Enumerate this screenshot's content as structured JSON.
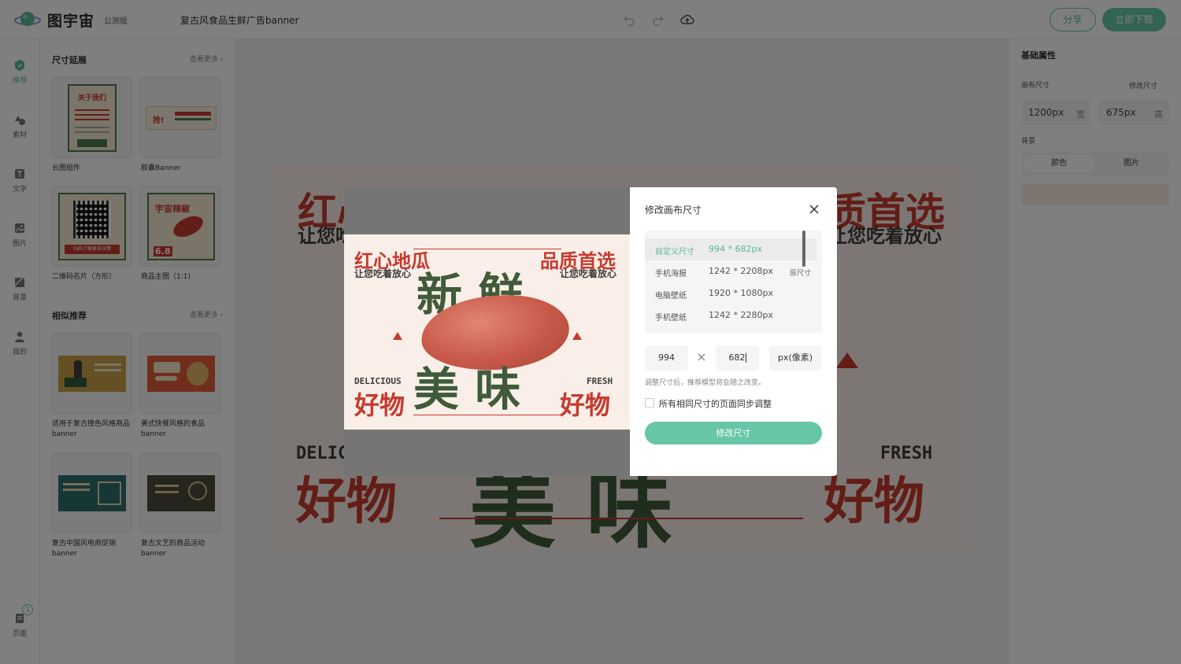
{
  "topbar": {
    "brand": "图宇宙",
    "beta": "公测版",
    "doc_title": "复古风食品生鲜广告banner",
    "share": "分享",
    "download": "立即下载"
  },
  "rail": {
    "items": [
      "推荐",
      "素材",
      "文字",
      "图片",
      "背景",
      "我的"
    ],
    "page_label": "页面",
    "page_count": "1"
  },
  "panel": {
    "section1": {
      "title": "尺寸延展",
      "more": "查看更多"
    },
    "tiles1": [
      {
        "label": "长图组件",
        "thumb_title": "关于我们"
      },
      {
        "label": "胶囊Banner",
        "thumb_title": "抢!"
      },
      {
        "label": "二维码名片（方形）",
        "thumb_title": "扫码了解更多详情"
      },
      {
        "label": "商品主图（1:1)",
        "thumb_title": "宇宙辣椒",
        "thumb_price": "6.8"
      }
    ],
    "section2": {
      "title": "相似推荐",
      "more": "查看更多"
    },
    "tiles2": [
      {
        "label": "适用于复古撞色风格商品banner"
      },
      {
        "label": "美式快餐风格的食品banner"
      },
      {
        "label": "复古中国风电商促销banner"
      },
      {
        "label": "复古文艺的商品活动banner"
      }
    ]
  },
  "artwork": {
    "top_left": "红心地瓜",
    "top_left_sub": "让您吃着放心",
    "top_right": "品质首选",
    "top_right_sub": "让您吃着放心",
    "big_top": "新 鲜",
    "big_bottom": "美 味",
    "delicious": "DELICIOUS",
    "fresh": "FRESH",
    "good": "好物"
  },
  "rpanel": {
    "title": "基础属性",
    "canvas_size_label": "画布尺寸",
    "edit_size": "修改尺寸",
    "width_value": "1200px",
    "width_unit": "宽",
    "height_value": "675px",
    "height_unit": "高",
    "bg_label": "背景",
    "bg_options": [
      "颜色",
      "图片"
    ]
  },
  "modal": {
    "title": "修改画布尺寸",
    "sizes": [
      {
        "name": "自定义尺寸",
        "dims": "994 * 682px",
        "tag": ""
      },
      {
        "name": "手机海报",
        "dims": "1242 * 2208px",
        "tag": "原尺寸"
      },
      {
        "name": "电脑壁纸",
        "dims": "1920 * 1080px",
        "tag": ""
      },
      {
        "name": "手机壁纸",
        "dims": "1242 * 2280px",
        "tag": ""
      }
    ],
    "width_input": "994",
    "height_input": "682",
    "unit": "px(像素)",
    "hint": "调整尺寸后，推荐模型将会随之改变。",
    "sync_label": "所有相同尺寸的页面同步调整",
    "submit": "修改尺寸"
  }
}
